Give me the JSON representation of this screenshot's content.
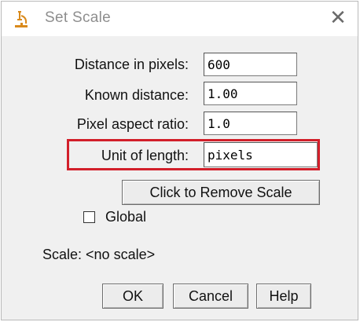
{
  "window": {
    "title": "Set Scale",
    "close_glyph": "✕"
  },
  "fields": {
    "distance_pixels": {
      "label": "Distance in pixels:",
      "value": "600"
    },
    "known_distance": {
      "label": "Known distance:",
      "value": "1.00"
    },
    "pixel_aspect_ratio": {
      "label": "Pixel aspect ratio:",
      "value": "1.0"
    },
    "unit_of_length": {
      "label": "Unit of length:",
      "value": "pixels"
    }
  },
  "buttons": {
    "remove_scale": "Click to Remove Scale",
    "ok": "OK",
    "cancel": "Cancel",
    "help": "Help"
  },
  "global_checkbox": {
    "label": "Global",
    "checked": false
  },
  "status": "Scale: <no scale>",
  "colors": {
    "highlight": "#d21f2a",
    "icon": "#d98a1c"
  },
  "icons": {
    "app": "microscope-icon",
    "close": "close-icon"
  }
}
